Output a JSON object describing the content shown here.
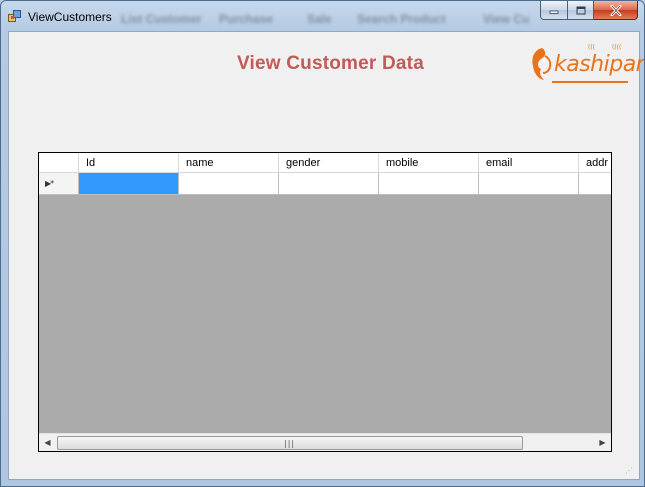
{
  "window": {
    "title": "ViewCustomers",
    "background_menu_items": [
      "List Customer",
      "Purchase",
      "Sale",
      "Search Product",
      "View Cu"
    ]
  },
  "header": {
    "heading": "View Customer Data",
    "heading_color": "#c25b58",
    "logo": {
      "text": "kashipara",
      "color": "#e8731c"
    }
  },
  "grid": {
    "columns": [
      "Id",
      "name",
      "gender",
      "mobile",
      "email",
      "addr"
    ],
    "selected_cell_color": "#3399ff",
    "new_row_marker": "▶*",
    "scrollbar_grip": "|||"
  }
}
